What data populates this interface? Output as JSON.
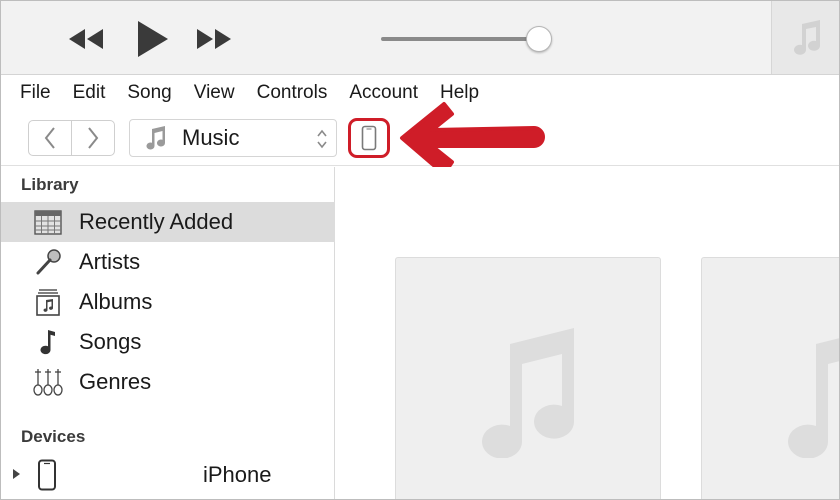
{
  "player": {
    "rewind_icon": "rewind-icon",
    "play_icon": "play-icon",
    "forward_icon": "fast-forward-icon",
    "volume_level": 0.92,
    "artwork_icon": "music-note-icon"
  },
  "menu": [
    "File",
    "Edit",
    "Song",
    "View",
    "Controls",
    "Account",
    "Help"
  ],
  "toolbar": {
    "media_kind": "Music",
    "device_button_icon": "iphone-icon",
    "annotation_color": "#cf1d28"
  },
  "sidebar": {
    "library_title": "Library",
    "items": [
      {
        "label": "Recently Added",
        "icon": "calendar-grid-icon",
        "selected": true
      },
      {
        "label": "Artists",
        "icon": "microphone-icon",
        "selected": false
      },
      {
        "label": "Albums",
        "icon": "album-icon",
        "selected": false
      },
      {
        "label": "Songs",
        "icon": "music-note-icon",
        "selected": false
      },
      {
        "label": "Genres",
        "icon": "guitar-icon",
        "selected": false
      }
    ],
    "devices_title": "Devices",
    "device": {
      "label": "iPhone",
      "icon": "iphone-icon"
    }
  },
  "colors": {
    "accent_red": "#cf1d28",
    "selected_row": "#dcdcdc",
    "toolbar_bg": "#f2f2f2"
  }
}
